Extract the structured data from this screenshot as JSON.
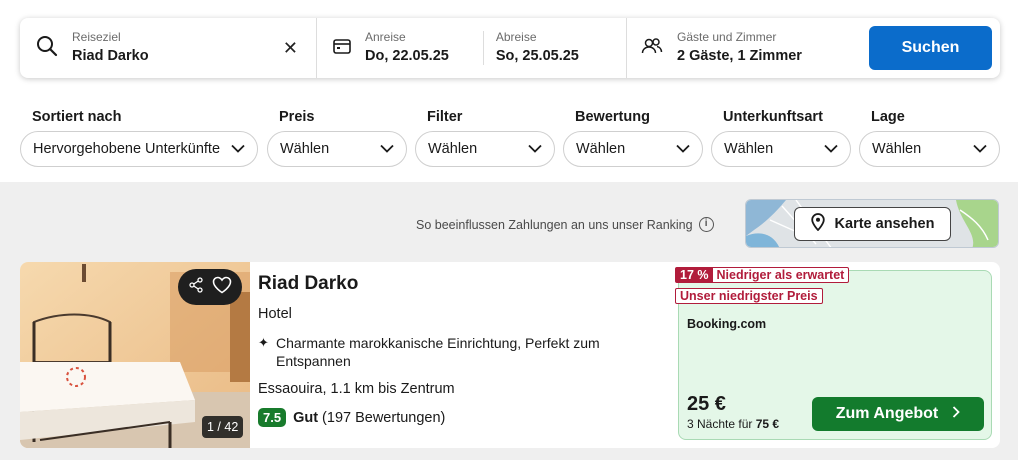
{
  "search": {
    "destination_label": "Reiseziel",
    "destination_value": "Riad Darko",
    "checkin_label": "Anreise",
    "checkin_value": "Do, 22.05.25",
    "checkout_label": "Abreise",
    "checkout_value": "So, 25.05.25",
    "guests_label": "Gäste und Zimmer",
    "guests_value": "2 Gäste, 1 Zimmer",
    "search_button": "Suchen"
  },
  "filters": [
    {
      "title": "Sortiert nach",
      "value": "Hervorgehobene Unterkünfte"
    },
    {
      "title": "Preis",
      "value": "Wählen"
    },
    {
      "title": "Filter",
      "value": "Wählen"
    },
    {
      "title": "Bewertung",
      "value": "Wählen"
    },
    {
      "title": "Unterkunftsart",
      "value": "Wählen"
    },
    {
      "title": "Lage",
      "value": "Wählen"
    }
  ],
  "ranking_note": "So beeinflussen Zahlungen an uns unser Ranking",
  "map_button": "Karte ansehen",
  "hotel": {
    "name": "Riad Darko",
    "type": "Hotel",
    "feature": "Charmante marokkanische Einrichtung, Perfekt zum Entspannen",
    "location": "Essaouira, 1.1 km bis Zentrum",
    "score": "7.5",
    "score_label": "Gut",
    "reviews": "(197 Bewertungen)",
    "photo_counter": "1 / 42"
  },
  "deal": {
    "discount_pct": "17 %",
    "discount_text": "Niedriger als erwartet",
    "lowest_price_tag": "Unser niedrigster Preis",
    "provider": "Booking.com",
    "price": "25 €",
    "total_prefix": "3 Nächte für",
    "total_value": "75 €",
    "button": "Zum Angebot"
  },
  "colors": {
    "primary_blue": "#0b6ccb",
    "deal_green": "#137b2d",
    "score_green": "#187b2c",
    "tag_red": "#b11c3b",
    "deal_bg": "#e4f7e8"
  }
}
